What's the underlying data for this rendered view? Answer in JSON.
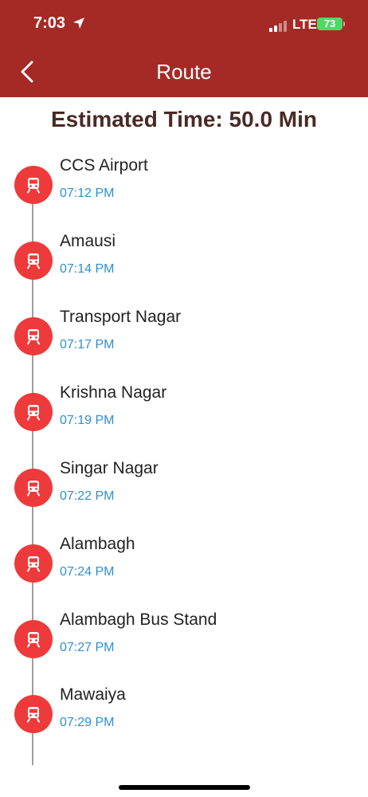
{
  "status_bar": {
    "time": "7:03",
    "network": "LTE",
    "battery": "73"
  },
  "header": {
    "title": "Route"
  },
  "estimated_time": "Estimated Time: 50.0 Min",
  "stops": [
    {
      "name": "CCS Airport",
      "time": "07:12 PM"
    },
    {
      "name": "Amausi",
      "time": "07:14 PM"
    },
    {
      "name": "Transport Nagar",
      "time": "07:17 PM"
    },
    {
      "name": "Krishna Nagar",
      "time": "07:19 PM"
    },
    {
      "name": "Singar Nagar",
      "time": "07:22 PM"
    },
    {
      "name": "Alambagh",
      "time": "07:24 PM"
    },
    {
      "name": "Alambagh Bus Stand",
      "time": "07:27 PM"
    },
    {
      "name": "Mawaiya",
      "time": "07:29 PM"
    }
  ],
  "icons": {
    "back": "chevron-left-icon",
    "stop": "train-icon",
    "location": "location-arrow-icon"
  },
  "colors": {
    "header_bg": "#a52a25",
    "stop_icon_bg": "#ee3a3a",
    "time_text": "#2d8fd8",
    "title_text": "#4a2a25",
    "route_line": "#9e9e9e"
  }
}
